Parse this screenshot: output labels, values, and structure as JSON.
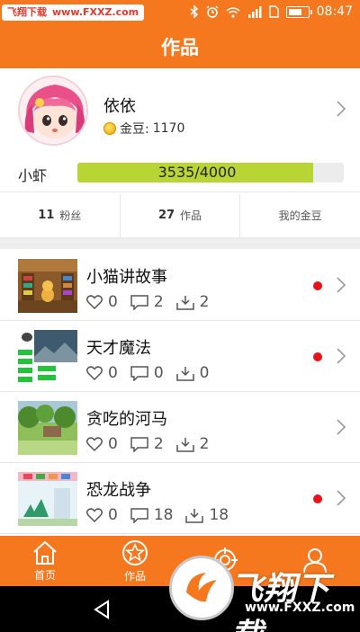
{
  "status_bar": {
    "watermark_name": "飞翔下载",
    "watermark_url": "www.FXXZ.com",
    "time": "08:47",
    "icons": [
      "bluetooth-icon",
      "alarm-icon",
      "wifi-icon",
      "signal-icon",
      "sim-icon",
      "battery-icon"
    ]
  },
  "header": {
    "title": "作品"
  },
  "profile": {
    "name": "依依",
    "coins_label": "金豆:",
    "coins_value": "1170"
  },
  "level": {
    "name": "小虾",
    "progress_text": "3535/4000",
    "progress": 0.884
  },
  "stats": [
    {
      "num": "11",
      "label": "粉丝"
    },
    {
      "num": "27",
      "label": "作品"
    },
    {
      "num": "",
      "label": "我的金豆"
    }
  ],
  "works": [
    {
      "title": "小猫讲故事",
      "likes": "0",
      "comments": "2",
      "downloads": "2",
      "unread": true
    },
    {
      "title": "天才魔法",
      "likes": "0",
      "comments": "0",
      "downloads": "0",
      "unread": true
    },
    {
      "title": "贪吃的河马",
      "likes": "0",
      "comments": "2",
      "downloads": "2",
      "unread": false
    },
    {
      "title": "恐龙战争",
      "likes": "0",
      "comments": "18",
      "downloads": "18",
      "unread": true
    }
  ],
  "bottom_nav": [
    {
      "label": "首页",
      "icon": "home-icon"
    },
    {
      "label": "作品",
      "icon": "star-icon"
    },
    {
      "label": "",
      "icon": "target-icon"
    },
    {
      "label": "",
      "icon": "user-icon"
    }
  ],
  "watermark": {
    "brand": "飞翔下载",
    "url": "www.FXXZ.com"
  },
  "colors": {
    "accent": "#f5781e",
    "progress": "#b8d435",
    "badge": "#e8121b"
  }
}
